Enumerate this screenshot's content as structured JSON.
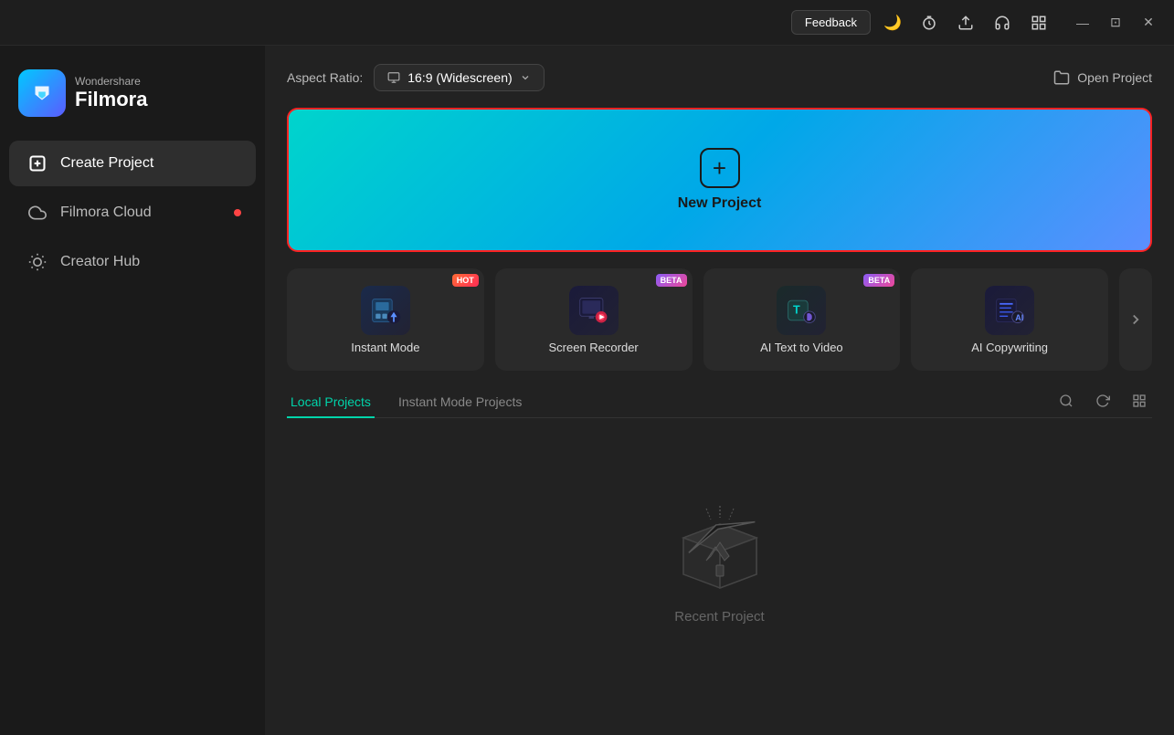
{
  "titleBar": {
    "feedback_label": "Feedback",
    "minimize_label": "—",
    "maximize_label": "⊞",
    "close_label": "✕",
    "icons": {
      "theme": "🌙",
      "timer": "⏱",
      "upload": "⬆",
      "support": "🎧",
      "grid": "⊞"
    }
  },
  "sidebar": {
    "logo": {
      "top": "Wondershare",
      "bottom": "Filmora"
    },
    "nav": [
      {
        "id": "create-project",
        "label": "Create Project",
        "icon": "➕",
        "active": true,
        "dot": false
      },
      {
        "id": "filmora-cloud",
        "label": "Filmora Cloud",
        "icon": "☁",
        "active": false,
        "dot": true
      },
      {
        "id": "creator-hub",
        "label": "Creator Hub",
        "icon": "💡",
        "active": false,
        "dot": false
      }
    ]
  },
  "content": {
    "aspectRatio": {
      "label": "Aspect Ratio:",
      "value": "16:9 (Widescreen)",
      "icon": "🖥"
    },
    "openProject": {
      "label": "Open Project",
      "icon": "📁"
    },
    "newProject": {
      "label": "New Project"
    },
    "featureCards": [
      {
        "id": "instant-mode",
        "label": "Instant Mode",
        "badge": "HOT",
        "badge_type": "hot"
      },
      {
        "id": "screen-recorder",
        "label": "Screen Recorder",
        "badge": "BETA",
        "badge_type": "beta"
      },
      {
        "id": "ai-text-to-video",
        "label": "AI Text to Video",
        "badge": "BETA",
        "badge_type": "beta"
      },
      {
        "id": "ai-copywriting",
        "label": "AI Copywriting",
        "badge": null,
        "badge_type": null
      }
    ],
    "projects": {
      "tabs": [
        {
          "id": "local-projects",
          "label": "Local Projects",
          "active": true
        },
        {
          "id": "instant-mode-projects",
          "label": "Instant Mode Projects",
          "active": false
        }
      ],
      "emptyState": {
        "label": "Recent Project"
      }
    }
  }
}
